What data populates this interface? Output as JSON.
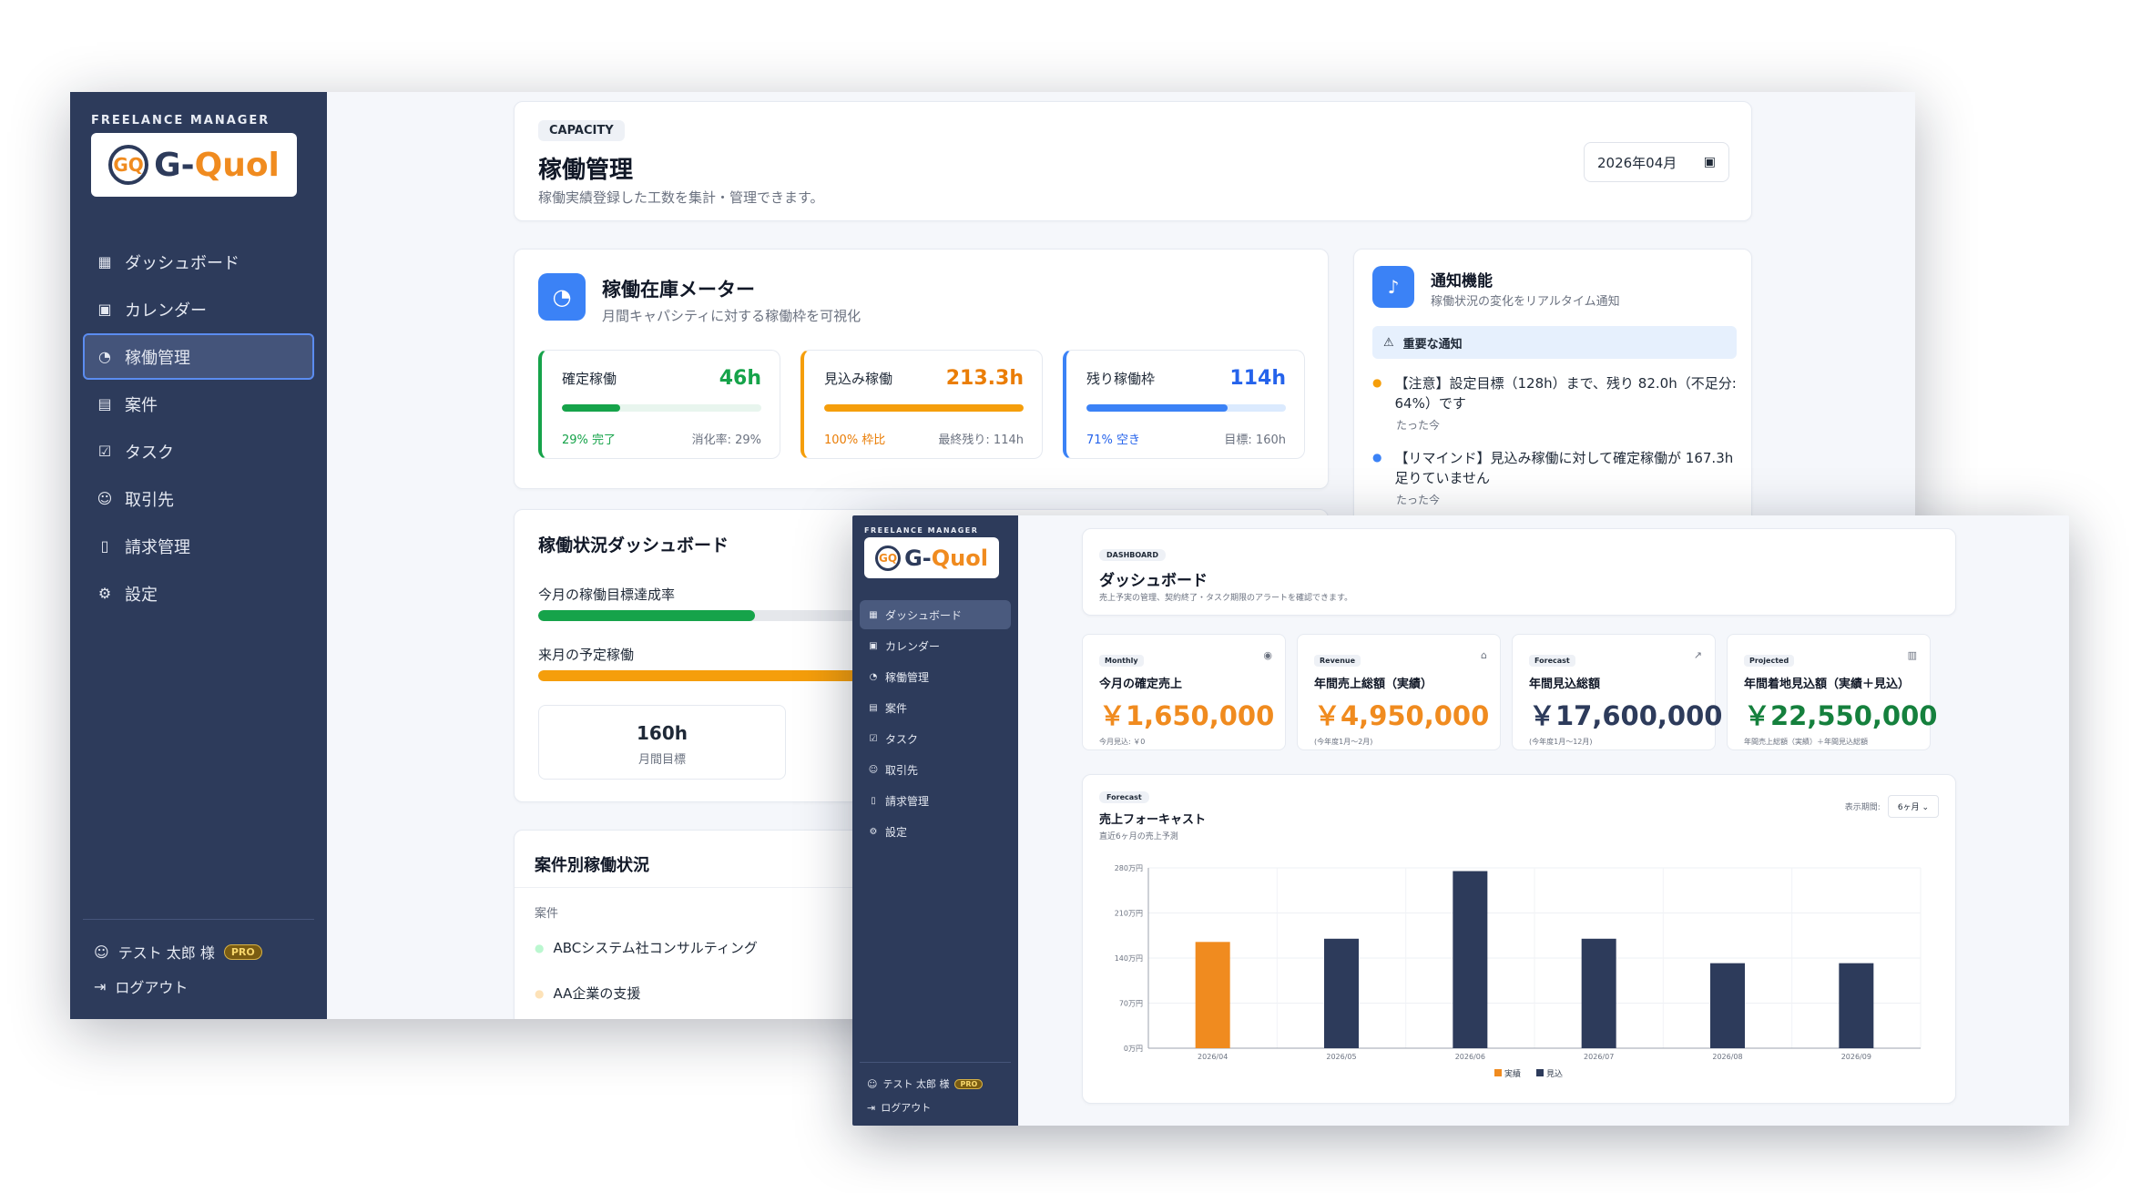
{
  "brand": {
    "caption": "FREELANCE MANAGER",
    "logo_part1": "G-",
    "logo_part2": "Quol",
    "mark": "GQ"
  },
  "nav": [
    {
      "label": "ダッシュボード",
      "icon": "grid-icon"
    },
    {
      "label": "カレンダー",
      "icon": "calendar-icon"
    },
    {
      "label": "稼働管理",
      "icon": "gauge-icon"
    },
    {
      "label": "案件",
      "icon": "briefcase-icon"
    },
    {
      "label": "タスク",
      "icon": "checkbox-icon"
    },
    {
      "label": "取引先",
      "icon": "users-icon"
    },
    {
      "label": "請求管理",
      "icon": "document-icon"
    },
    {
      "label": "設定",
      "icon": "gear-icon"
    }
  ],
  "user": {
    "name": "テスト 太郎 様",
    "badge": "PRO",
    "logout": "ログアウト"
  },
  "capacity": {
    "header": {
      "chip": "CAPACITY",
      "title": "稼働管理",
      "subtitle": "稼働実績登録した工数を集計・管理できます。",
      "month": "2026年04月"
    },
    "meter": {
      "title": "稼働在庫メーター",
      "subtitle": "月間キャパシティに対する稼働枠を可視化",
      "items": [
        {
          "label": "確定稼働",
          "value": "46h",
          "left": "29% 完了",
          "right": "消化率: 29%",
          "fill": 0.29,
          "color": "#16a34a"
        },
        {
          "label": "見込み稼働",
          "value": "213.3h",
          "left": "100% 枠比",
          "right": "最終残り: 114h",
          "fill": 1.0,
          "color": "#f59e0b"
        },
        {
          "label": "残り稼働枠",
          "value": "114h",
          "left": "71% 空き",
          "right": "目標: 160h",
          "fill": 0.71,
          "color": "#3b82f6"
        }
      ]
    },
    "notify": {
      "title": "通知機能",
      "subtitle": "稼働状況の変化をリアルタイム通知",
      "important": "重要な通知",
      "items": [
        {
          "text": "【注意】設定目標（128h）まで、残り 82.0h（不足分: 64%）です",
          "time": "たった今",
          "color": "#f59e0b"
        },
        {
          "text": "【リマインド】見込み稼働に対して確定稼働が 167.3h 足りていません",
          "time": "たった今",
          "color": "#3b82f6"
        }
      ]
    },
    "status": {
      "title": "稼働状況ダッシュボード",
      "row1": "今月の稼働目標達成率",
      "row1_fill": 0.29,
      "row2": "来月の予定稼働",
      "row2_fill": 1.0,
      "box_value": "160h",
      "box_label": "月間目標"
    },
    "projects": {
      "title": "案件別稼働状況",
      "col": "案件",
      "rows": [
        {
          "name": "ABCシステム社コンサルティング",
          "color": "#bbf7d0"
        },
        {
          "name": "AA企業の支援",
          "color": "#fde2b8"
        }
      ]
    }
  },
  "dashboard": {
    "header": {
      "chip": "DASHBOARD",
      "title": "ダッシュボード",
      "subtitle": "売上予実の管理、契約終了・タスク期限のアラートを確認できます。"
    },
    "kpis": [
      {
        "tag": "Monthly",
        "label": "今月の確定売上",
        "value": "￥1,650,000",
        "sub": "今月見込: ￥0",
        "color": "#f08b1f",
        "icon": "coin-icon"
      },
      {
        "tag": "Revenue",
        "label": "年間売上総額（実績）",
        "value": "￥4,950,000",
        "sub": "(今年度1月〜2月)",
        "color": "#f08b1f",
        "icon": "bank-icon"
      },
      {
        "tag": "Forecast",
        "label": "年間見込総額",
        "value": "￥17,600,000",
        "sub": "(今年度1月〜12月)",
        "color": "#2d3b5b",
        "icon": "trend-icon"
      },
      {
        "tag": "Projected",
        "label": "年間着地見込額（実績＋見込）",
        "value": "￥22,550,000",
        "sub": "年間売上総額（実績）＋年間見込総額",
        "color": "#15803d",
        "icon": "bar-chart-icon"
      }
    ],
    "forecast": {
      "chip": "Forecast",
      "title": "売上フォーキャスト",
      "subtitle": "直近6ヶ月の売上予測",
      "period_label": "表示期間:",
      "period_value": "6ヶ月"
    }
  },
  "chart_data": {
    "type": "bar",
    "categories": [
      "2026/04",
      "2026/05",
      "2026/06",
      "2026/07",
      "2026/08",
      "2026/09"
    ],
    "series": [
      {
        "name": "実績",
        "values": [
          165,
          0,
          0,
          0,
          0,
          0
        ],
        "color": "#f08b1f"
      },
      {
        "name": "見込",
        "values": [
          0,
          170,
          275,
          170,
          132,
          132
        ],
        "color": "#2d3b5b"
      }
    ],
    "yticks": [
      "0万円",
      "70万円",
      "140万円",
      "210万円",
      "280万円"
    ],
    "ylim": [
      0,
      280
    ],
    "legend": "bottom",
    "grid": true
  }
}
